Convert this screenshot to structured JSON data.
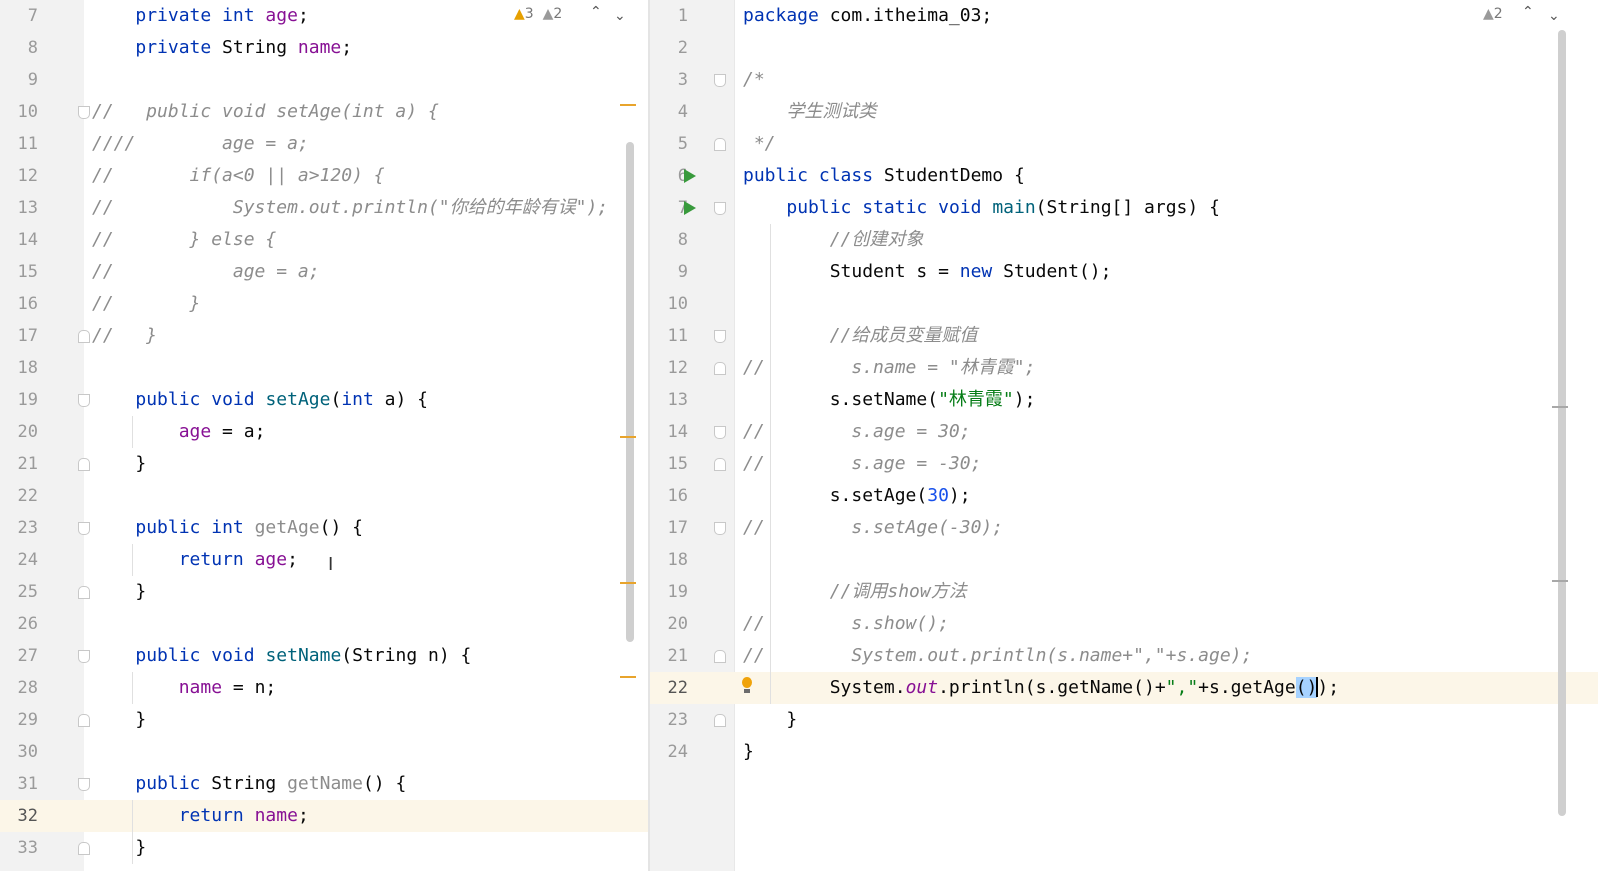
{
  "left_editor": {
    "inspections": {
      "warnings": "3",
      "weak_warnings": "2"
    },
    "lines": [
      {
        "n": "7",
        "tokens": [
          {
            "t": "    "
          },
          {
            "t": "private",
            "c": "kw"
          },
          {
            "t": " "
          },
          {
            "t": "int",
            "c": "kw"
          },
          {
            "t": " "
          },
          {
            "t": "age",
            "c": "fld"
          },
          {
            "t": ";"
          }
        ]
      },
      {
        "n": "8",
        "tokens": [
          {
            "t": "    "
          },
          {
            "t": "private",
            "c": "kw"
          },
          {
            "t": " String "
          },
          {
            "t": "name",
            "c": "fld"
          },
          {
            "t": ";"
          }
        ]
      },
      {
        "n": "9",
        "tokens": []
      },
      {
        "n": "10",
        "tokens": [
          {
            "t": "//   public void setAge(int a) {",
            "c": "cmt"
          }
        ]
      },
      {
        "n": "11",
        "tokens": [
          {
            "t": "////        age = a;",
            "c": "cmt"
          }
        ]
      },
      {
        "n": "12",
        "tokens": [
          {
            "t": "//       if(a<0 || a>120) {",
            "c": "cmt"
          }
        ]
      },
      {
        "n": "13",
        "tokens": [
          {
            "t": "//           System.out.println(\"你给的年龄有误\");",
            "c": "cmt"
          }
        ]
      },
      {
        "n": "14",
        "tokens": [
          {
            "t": "//       } else {",
            "c": "cmt"
          }
        ]
      },
      {
        "n": "15",
        "tokens": [
          {
            "t": "//           age = a;",
            "c": "cmt"
          }
        ]
      },
      {
        "n": "16",
        "tokens": [
          {
            "t": "//       }",
            "c": "cmt"
          }
        ]
      },
      {
        "n": "17",
        "tokens": [
          {
            "t": "//   }",
            "c": "cmt"
          }
        ]
      },
      {
        "n": "18",
        "tokens": []
      },
      {
        "n": "19",
        "tokens": [
          {
            "t": "    "
          },
          {
            "t": "public",
            "c": "kw"
          },
          {
            "t": " "
          },
          {
            "t": "void",
            "c": "kw"
          },
          {
            "t": " "
          },
          {
            "t": "setAge",
            "c": "fn"
          },
          {
            "t": "("
          },
          {
            "t": "int",
            "c": "kw"
          },
          {
            "t": " a) {"
          }
        ]
      },
      {
        "n": "20",
        "tokens": [
          {
            "t": "        "
          },
          {
            "t": "age",
            "c": "fld"
          },
          {
            "t": " = a;"
          }
        ]
      },
      {
        "n": "21",
        "tokens": [
          {
            "t": "    }"
          }
        ]
      },
      {
        "n": "22",
        "tokens": []
      },
      {
        "n": "23",
        "tokens": [
          {
            "t": "    "
          },
          {
            "t": "public",
            "c": "kw"
          },
          {
            "t": " "
          },
          {
            "t": "int",
            "c": "kw"
          },
          {
            "t": " "
          },
          {
            "t": "getAge",
            "c": "dim"
          },
          {
            "t": "() {"
          }
        ]
      },
      {
        "n": "24",
        "tokens": [
          {
            "t": "        "
          },
          {
            "t": "return",
            "c": "kw"
          },
          {
            "t": " "
          },
          {
            "t": "age",
            "c": "fld"
          },
          {
            "t": ";"
          }
        ]
      },
      {
        "n": "25",
        "tokens": [
          {
            "t": "    }"
          }
        ]
      },
      {
        "n": "26",
        "tokens": []
      },
      {
        "n": "27",
        "tokens": [
          {
            "t": "    "
          },
          {
            "t": "public",
            "c": "kw"
          },
          {
            "t": " "
          },
          {
            "t": "void",
            "c": "kw"
          },
          {
            "t": " "
          },
          {
            "t": "setName",
            "c": "fn"
          },
          {
            "t": "(String n) {"
          }
        ]
      },
      {
        "n": "28",
        "tokens": [
          {
            "t": "        "
          },
          {
            "t": "name",
            "c": "fld"
          },
          {
            "t": " = n;"
          }
        ]
      },
      {
        "n": "29",
        "tokens": [
          {
            "t": "    }"
          }
        ]
      },
      {
        "n": "30",
        "tokens": []
      },
      {
        "n": "31",
        "tokens": [
          {
            "t": "    "
          },
          {
            "t": "public",
            "c": "kw"
          },
          {
            "t": " String "
          },
          {
            "t": "getName",
            "c": "dim"
          },
          {
            "t": "() {"
          }
        ]
      },
      {
        "n": "32",
        "current": true,
        "tokens": [
          {
            "t": "        "
          },
          {
            "t": "return",
            "c": "kw"
          },
          {
            "t": " "
          },
          {
            "t": "name",
            "c": "fld"
          },
          {
            "t": ";"
          }
        ]
      },
      {
        "n": "33",
        "tokens": [
          {
            "t": "    }"
          }
        ]
      }
    ]
  },
  "right_editor": {
    "inspections": {
      "weak_warnings": "2"
    },
    "lines": [
      {
        "n": "1",
        "tokens": [
          {
            "t": "package",
            "c": "kw"
          },
          {
            "t": " com.itheima_03;"
          }
        ]
      },
      {
        "n": "2",
        "tokens": []
      },
      {
        "n": "3",
        "tokens": [
          {
            "t": "/*",
            "c": "cmt"
          }
        ]
      },
      {
        "n": "4",
        "tokens": [
          {
            "t": "    学生测试类",
            "c": "cmt"
          }
        ]
      },
      {
        "n": "5",
        "tokens": [
          {
            "t": " */",
            "c": "cmt"
          }
        ]
      },
      {
        "n": "6",
        "tokens": [
          {
            "t": "public",
            "c": "kw"
          },
          {
            "t": " "
          },
          {
            "t": "class",
            "c": "kw"
          },
          {
            "t": " StudentDemo {"
          }
        ]
      },
      {
        "n": "7",
        "tokens": [
          {
            "t": "    "
          },
          {
            "t": "public",
            "c": "kw"
          },
          {
            "t": " "
          },
          {
            "t": "static",
            "c": "kw"
          },
          {
            "t": " "
          },
          {
            "t": "void",
            "c": "kw"
          },
          {
            "t": " "
          },
          {
            "t": "main",
            "c": "fn"
          },
          {
            "t": "(String[] args) {"
          }
        ]
      },
      {
        "n": "8",
        "tokens": [
          {
            "t": "        "
          },
          {
            "t": "//创建对象",
            "c": "cmt"
          }
        ]
      },
      {
        "n": "9",
        "tokens": [
          {
            "t": "        Student s = "
          },
          {
            "t": "new",
            "c": "kw"
          },
          {
            "t": " Student();"
          }
        ]
      },
      {
        "n": "10",
        "tokens": []
      },
      {
        "n": "11",
        "tokens": [
          {
            "t": "        "
          },
          {
            "t": "//给成员变量赋值",
            "c": "cmt"
          }
        ]
      },
      {
        "n": "12",
        "tokens": [
          {
            "t": "//        s.name = \"林青霞\";",
            "c": "cmt"
          }
        ]
      },
      {
        "n": "13",
        "tokens": [
          {
            "t": "        s.setName("
          },
          {
            "t": "\"林青霞\"",
            "c": "str"
          },
          {
            "t": ");"
          }
        ]
      },
      {
        "n": "14",
        "tokens": [
          {
            "t": "//        s.age = 30;",
            "c": "cmt"
          }
        ]
      },
      {
        "n": "15",
        "tokens": [
          {
            "t": "//        s.age = -30;",
            "c": "cmt"
          }
        ]
      },
      {
        "n": "16",
        "tokens": [
          {
            "t": "        s.setAge("
          },
          {
            "t": "30",
            "c": "num"
          },
          {
            "t": ");"
          }
        ]
      },
      {
        "n": "17",
        "tokens": [
          {
            "t": "//        s.setAge(-30);",
            "c": "cmt"
          }
        ]
      },
      {
        "n": "18",
        "tokens": []
      },
      {
        "n": "19",
        "tokens": [
          {
            "t": "        "
          },
          {
            "t": "//调用show方法",
            "c": "cmt"
          }
        ]
      },
      {
        "n": "20",
        "tokens": [
          {
            "t": "//        s.show();",
            "c": "cmt"
          }
        ]
      },
      {
        "n": "21",
        "tokens": [
          {
            "t": "//        System.out.println(s.name+\",\"+s.age);",
            "c": "cmt"
          }
        ]
      },
      {
        "n": "22",
        "current": true,
        "tokens": [
          {
            "t": "        System."
          },
          {
            "t": "out",
            "c": "static-fld"
          },
          {
            "t": ".println(s.getName()+"
          },
          {
            "t": "\",\"",
            "c": "str"
          },
          {
            "t": "+s.getAge"
          },
          {
            "t": "()",
            "c": "hl"
          },
          {
            "t": ");"
          }
        ]
      },
      {
        "n": "23",
        "tokens": [
          {
            "t": "    }"
          }
        ]
      },
      {
        "n": "24",
        "tokens": [
          {
            "t": "}"
          }
        ]
      }
    ]
  },
  "colors": {
    "keyword": "#0033b3",
    "field": "#871094",
    "comment": "#8c8c8c",
    "string": "#067d17",
    "number": "#1750eb",
    "run": "#389a3c",
    "warning": "#e6a000"
  },
  "icons": [
    "warning-icon",
    "weak-warning-icon",
    "chevron-up-icon",
    "chevron-down-icon",
    "run-icon",
    "bulb-icon",
    "fold-icon"
  ]
}
